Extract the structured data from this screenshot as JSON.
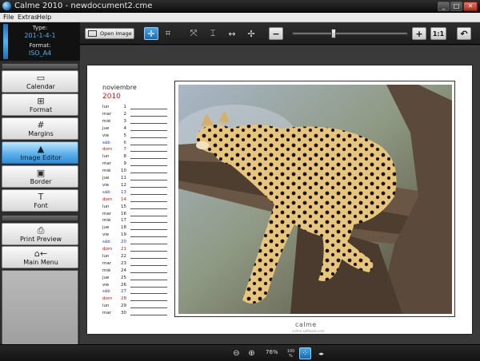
{
  "window": {
    "title": "Calme 2010 - newdocument2.cme",
    "buttons": [
      "_",
      "□",
      "✕"
    ]
  },
  "menu": [
    "File",
    "Extras",
    "Help"
  ],
  "info": {
    "type_label": "Type:",
    "type_value": "201-1-4-1",
    "format_label": "Format:",
    "format_value": "ISO_A4"
  },
  "toolbar": {
    "open_image_label": "Open Image",
    "ratio_label": "1:1",
    "zoom_slider_level": 0.36
  },
  "sidebar": [
    {
      "label": "Calendar",
      "icon": "calendar-icon",
      "glyph": "▭",
      "active": false
    },
    {
      "label": "Format",
      "icon": "format-icon",
      "glyph": "⊞",
      "active": false
    },
    {
      "label": "Margins",
      "icon": "margins-icon",
      "glyph": "#",
      "active": false
    },
    {
      "label": "Image Editor",
      "icon": "image-editor-icon",
      "glyph": "▲",
      "active": true
    },
    {
      "label": "Border",
      "icon": "border-icon",
      "glyph": "▣",
      "active": false
    },
    {
      "label": "Font",
      "icon": "font-icon",
      "glyph": "T",
      "active": false
    },
    {
      "label": "Print Preview",
      "icon": "print-preview-icon",
      "glyph": "⎙",
      "active": false
    },
    {
      "label": "Main Menu",
      "icon": "main-menu-icon",
      "glyph": "⌂←",
      "active": false
    }
  ],
  "calendar": {
    "month": "noviembre",
    "year": "2010",
    "days": [
      {
        "d": "lun",
        "n": "1",
        "t": "w"
      },
      {
        "d": "mar",
        "n": "2",
        "t": "w"
      },
      {
        "d": "mié",
        "n": "3",
        "t": "w"
      },
      {
        "d": "jue",
        "n": "4",
        "t": "w"
      },
      {
        "d": "vie",
        "n": "5",
        "t": "w"
      },
      {
        "d": "sáb",
        "n": "6",
        "t": "sat"
      },
      {
        "d": "dom",
        "n": "7",
        "t": "sun"
      },
      {
        "d": "lun",
        "n": "8",
        "t": "w"
      },
      {
        "d": "mar",
        "n": "9",
        "t": "w"
      },
      {
        "d": "mié",
        "n": "10",
        "t": "w"
      },
      {
        "d": "jue",
        "n": "11",
        "t": "w"
      },
      {
        "d": "vie",
        "n": "12",
        "t": "w"
      },
      {
        "d": "sáb",
        "n": "13",
        "t": "sat"
      },
      {
        "d": "dom",
        "n": "14",
        "t": "sun"
      },
      {
        "d": "lun",
        "n": "15",
        "t": "w"
      },
      {
        "d": "mar",
        "n": "16",
        "t": "w"
      },
      {
        "d": "mié",
        "n": "17",
        "t": "w"
      },
      {
        "d": "jue",
        "n": "18",
        "t": "w"
      },
      {
        "d": "vie",
        "n": "19",
        "t": "w"
      },
      {
        "d": "sáb",
        "n": "20",
        "t": "sat"
      },
      {
        "d": "dom",
        "n": "21",
        "t": "sun"
      },
      {
        "d": "lun",
        "n": "22",
        "t": "w"
      },
      {
        "d": "mar",
        "n": "23",
        "t": "w"
      },
      {
        "d": "mié",
        "n": "24",
        "t": "w"
      },
      {
        "d": "jue",
        "n": "25",
        "t": "w"
      },
      {
        "d": "vie",
        "n": "26",
        "t": "w"
      },
      {
        "d": "sáb",
        "n": "27",
        "t": "sat"
      },
      {
        "d": "dom",
        "n": "28",
        "t": "sun"
      },
      {
        "d": "lun",
        "n": "29",
        "t": "w"
      },
      {
        "d": "mar",
        "n": "30",
        "t": "w"
      }
    ],
    "brand": "calme",
    "brand_sub": "calme-software.com"
  },
  "status": {
    "zoom": "76%",
    "fit_label": "100 %"
  },
  "colors": {
    "accent": "#2f8ed8",
    "sunday": "#c01818",
    "saturday": "#2a40c0"
  }
}
